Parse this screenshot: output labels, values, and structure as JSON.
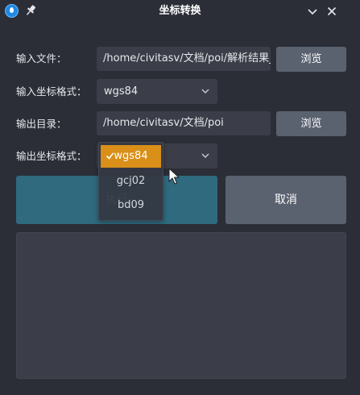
{
  "window": {
    "title": "坐标转换"
  },
  "form": {
    "input_file": {
      "label": "输入文件：",
      "value": "/home/civitasv/文档/poi/解析结果_",
      "browse_label": "浏览"
    },
    "input_format": {
      "label": "输入坐标格式：",
      "value": "wgs84"
    },
    "output_dir": {
      "label": "输出目录：",
      "value": "/home/civitasv/文档/poi",
      "browse_label": "浏览"
    },
    "output_format": {
      "label": "输出坐标格式：",
      "value": "wgs84",
      "options": [
        "wgs84",
        "gcj02",
        "bd09"
      ]
    }
  },
  "actions": {
    "execute_label": "执行",
    "cancel_label": "取消"
  },
  "icons": {
    "app": "globe-pin-icon",
    "pin": "pin-icon",
    "minimize": "chevron-down-icon",
    "close": "close-icon",
    "combo": "chevron-down-icon",
    "check": "check-icon",
    "cursor": "mouse-pointer-icon"
  },
  "colors": {
    "window_bg": "#2b2e37",
    "field_bg": "#3b3e48",
    "button_bg": "#5a6270",
    "execute_bg": "#2f6a7f",
    "selected_option_bg": "#d98f18"
  }
}
